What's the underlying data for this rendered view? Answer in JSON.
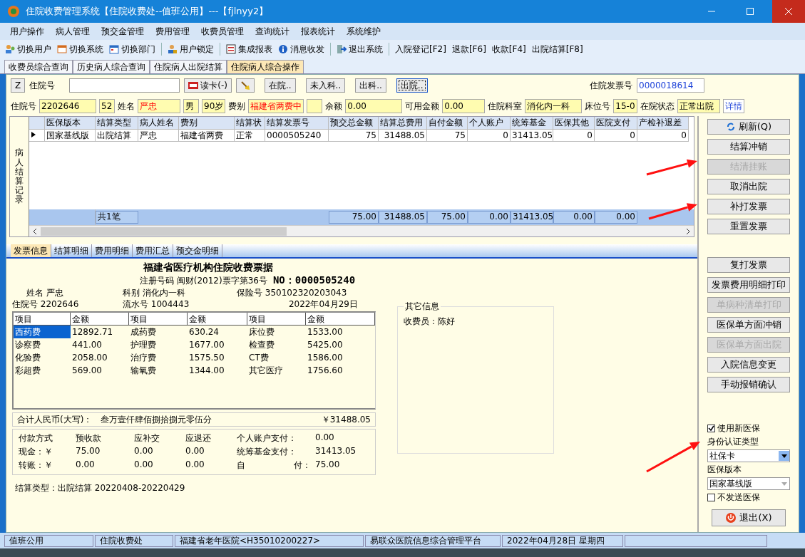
{
  "window": {
    "title": "住院收费管理系统【住院收费处--值班公用】---【fjlnyy2】"
  },
  "menu": [
    "用户操作",
    "病人管理",
    "预交金管理",
    "费用管理",
    "收费员管理",
    "查询统计",
    "报表统计",
    "系统维护"
  ],
  "toolbar": [
    [
      {
        "label": "切换用户",
        "kind": "users"
      },
      {
        "label": "切换系统",
        "kind": "switch"
      },
      {
        "label": "切换部门",
        "kind": "dept"
      }
    ],
    [
      {
        "label": "用户锁定",
        "kind": "lock"
      }
    ],
    [
      {
        "label": "集成报表",
        "kind": "report"
      },
      {
        "label": "消息收发",
        "kind": "info"
      }
    ],
    [
      {
        "label": "退出系统",
        "kind": "exit"
      }
    ],
    [
      {
        "label": "入院登记[F2]",
        "kind": "text"
      },
      {
        "label": "退款[F6]",
        "kind": "text"
      },
      {
        "label": "收款[F4]",
        "kind": "text"
      },
      {
        "label": "出院结算[F8]",
        "kind": "text"
      }
    ]
  ],
  "tabs": [
    {
      "label": "收费员综合查询",
      "selected": false
    },
    {
      "label": "历史病人综合查询",
      "selected": false
    },
    {
      "label": "住院病人出院结算",
      "selected": false
    },
    {
      "label": "住院病人综合操作",
      "selected": true
    }
  ],
  "search": {
    "z_key": "Z",
    "label": "住院号",
    "read_card": "读卡(-)",
    "filters": [
      {
        "label": "在院..",
        "selected": false
      },
      {
        "label": "未入科..",
        "selected": false
      },
      {
        "label": "出科..",
        "selected": false
      },
      {
        "label": "出院..",
        "selected": true
      }
    ],
    "invoice_label": "住院发票号",
    "invoice_value": "0000018614"
  },
  "patient": [
    {
      "label": "住院号",
      "value": "2202646",
      "kind": "wide",
      "highlight": false
    },
    {
      "value": "52",
      "kind": "short",
      "highlight": false
    },
    {
      "label": "姓名",
      "value": "严忠",
      "kind": "mid",
      "highlight": true
    },
    {
      "value": "男",
      "kind": "short",
      "highlight": false
    },
    {
      "value": "90岁",
      "kind": "short",
      "highlight": false
    },
    {
      "label": "费别",
      "value": "福建省两费中",
      "kind": "mid",
      "highlight": true
    },
    {
      "kind": "blank"
    },
    {
      "label": "余额",
      "value": "0.00",
      "kind": "wide",
      "highlight": false
    },
    {
      "label": "可用金额",
      "value": "0.00",
      "kind": "mid",
      "highlight": false
    },
    {
      "label": "住院科室",
      "value": "消化内一科",
      "kind": "wide",
      "highlight": false
    },
    {
      "label": "床位号",
      "value": "15-0",
      "kind": "short",
      "highlight": false
    },
    {
      "label": "在院状态",
      "value": "正常出院",
      "kind": "mid",
      "highlight": false
    },
    {
      "value": "详情",
      "kind": "link",
      "highlight": false
    }
  ],
  "records": {
    "side_label": "病人结算记录",
    "columns": [
      "医保版本",
      "结算类型",
      "病人姓名",
      "费别",
      "结算状",
      "结算发票号",
      "预交总金额",
      "结算总费用",
      "自付金额",
      "个人账户",
      "统筹基金",
      "医保其他",
      "医院支付",
      "产检补退差"
    ],
    "rows": [
      {
        "selected": true,
        "cells": [
          "国家基线版",
          "出院结算",
          "严忠",
          "福建省两费",
          "正常",
          "0000505240",
          "75",
          "31488.05",
          "75",
          "0",
          "31413.05",
          "0",
          "0",
          "0"
        ]
      }
    ],
    "footer_count": "共1笔",
    "footer_sums": [
      "75.00",
      "31488.05",
      "75.00",
      "0.00",
      "31413.05",
      "0.00",
      "0.00"
    ]
  },
  "detail_tabs": [
    {
      "label": "发票信息",
      "selected": true
    },
    {
      "label": "结算明细",
      "selected": false
    },
    {
      "label": "费用明细",
      "selected": false
    },
    {
      "label": "费用汇总",
      "selected": false
    },
    {
      "label": "预交金明细",
      "selected": false
    }
  ],
  "invoice": {
    "title": "福建省医疗机构住院收费票据",
    "registration": "注册号码 闽财(2012)票字第36号",
    "no_label": "NO：",
    "no": "0000505240",
    "info_rows": [
      [
        {
          "label": "姓名",
          "value": "严忠"
        },
        {
          "label": "科别",
          "value": "消化内一科"
        },
        {
          "label": "保险号",
          "value": "350102320203043"
        }
      ],
      [
        {
          "label": "住院号",
          "value": "2202646"
        },
        {
          "label": "流水号",
          "value": "1004443"
        },
        {
          "value": "2022年04月29日"
        }
      ]
    ],
    "item_headers": [
      "项目",
      "金额",
      "项目",
      "金额",
      "项目",
      "金额"
    ],
    "items": [
      [
        {
          "name": "西药费",
          "amount": "12892.71",
          "selected": true
        },
        {
          "name": "成药费",
          "amount": "630.24",
          "selected": false
        },
        {
          "name": "床位费",
          "amount": "1533.00",
          "selected": false
        }
      ],
      [
        {
          "name": "诊察费",
          "amount": "441.00",
          "selected": false
        },
        {
          "name": "护理费",
          "amount": "1677.00",
          "selected": false
        },
        {
          "name": "检查费",
          "amount": "5425.00",
          "selected": false
        }
      ],
      [
        {
          "name": "化验费",
          "amount": "2058.00",
          "selected": false
        },
        {
          "name": "治疗费",
          "amount": "1575.50",
          "selected": false
        },
        {
          "name": "CT费",
          "amount": "1586.00",
          "selected": false
        }
      ],
      [
        {
          "name": "彩超费",
          "amount": "569.00",
          "selected": false
        },
        {
          "name": "输氧费",
          "amount": "1344.00",
          "selected": false
        },
        {
          "name": "其它医疗",
          "amount": "1756.60",
          "selected": false
        }
      ]
    ],
    "total_label": "合计人民币(大写)：",
    "total_words": "叁万壹仟肆佰捌拾捌元零伍分",
    "total_amount": "￥31488.05",
    "pay_headers": [
      "付款方式",
      "预收款",
      "应补交",
      "应退还"
    ],
    "pay_rows": [
      [
        "现金：￥",
        "75.00",
        "0.00",
        "0.00"
      ],
      [
        "转账：￥",
        "0.00",
        "0.00",
        "0.00"
      ]
    ],
    "pay_side": [
      {
        "label": [
          "个人账户支付："
        ],
        "value": "0.00"
      },
      {
        "label": [
          "统筹基金支付："
        ],
        "value": "31413.05"
      },
      {
        "label": [
          "自",
          "付："
        ],
        "value": "75.00"
      }
    ],
    "settle": "结算类型：出院结算  20220408-20220429"
  },
  "other_info": {
    "title": "其它信息",
    "lines": [
      "收费员：陈好"
    ]
  },
  "actions_top": [
    {
      "label": "刷新(Q)",
      "kind": "refresh",
      "disabled": false
    },
    {
      "label": "结算冲销",
      "kind": "plain",
      "disabled": false
    },
    {
      "label": "结清挂账",
      "kind": "plain",
      "disabled": true
    },
    {
      "label": "取消出院",
      "kind": "plain",
      "disabled": false
    },
    {
      "label": "补打发票",
      "kind": "plain",
      "disabled": false
    },
    {
      "label": "重置发票",
      "kind": "plain",
      "disabled": false
    }
  ],
  "actions_bottom": [
    {
      "label": "复打发票",
      "kind": "plain",
      "disabled": false
    },
    {
      "label": "发票费用明细打印",
      "kind": "plain",
      "disabled": false
    },
    {
      "label": "单病种清单打印",
      "kind": "plain",
      "disabled": true
    },
    {
      "label": "医保单方面冲销",
      "kind": "plain",
      "disabled": false
    },
    {
      "label": "医保单方面出院",
      "kind": "plain",
      "disabled": true
    },
    {
      "label": "入院信息变更",
      "kind": "plain",
      "disabled": false
    },
    {
      "label": "手动报销确认",
      "kind": "plain",
      "disabled": false
    }
  ],
  "insurance": {
    "use_new": {
      "label": "使用新医保",
      "checked": true
    },
    "id_type_label": "身份认证类型",
    "id_type": {
      "value": "社保卡",
      "disabled": false
    },
    "version_label": "医保版本",
    "version": {
      "value": "国家基线版",
      "disabled": true
    },
    "no_send": {
      "label": "不发送医保",
      "checked": false
    }
  },
  "exit_button": "退出(X)",
  "status_bar": [
    "值班公用",
    "住院收费处",
    "福建省老年医院<H35010200227>",
    "易联众医院信息综合管理平台",
    "2022年04月28日 星期四"
  ]
}
